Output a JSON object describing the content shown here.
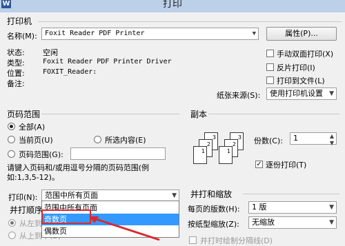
{
  "window": {
    "title": "打印",
    "app_icon": "W"
  },
  "printer": {
    "section": "打印机",
    "name_label": "名称(M):",
    "name_value": "Foxit Reader PDF Printer",
    "properties_btn": "属性(P)...",
    "status_label": "状态:",
    "status_value": "空闲",
    "type_label": "类型:",
    "type_value": "Foxit Reader PDF Printer Driver",
    "where_label": "位置:",
    "where_value": "FOXIT_Reader:",
    "comment_label": "备注:",
    "manual_duplex": "手动双面打印(X)",
    "reverse_print": "反片打印(I)",
    "print_to_file": "打印到文件(L)",
    "paper_source_label": "纸张来源(S):",
    "paper_source_value": "使用打印机设置"
  },
  "page_range": {
    "section": "页码范围",
    "all": "全部(A)",
    "current": "当前页(U)",
    "selection": "所选内容(E)",
    "pages": "页码范围(G):",
    "hint": "请键入页码和/或用逗号分隔的页码范围(例如:1,3,5-12)。"
  },
  "copies": {
    "section": "副本",
    "count_label": "份数(C):",
    "count_value": "1",
    "collate": "逐份打印(T)",
    "page_labels": [
      "3",
      "2",
      "1"
    ]
  },
  "print": {
    "label": "打印(N):",
    "value": "范围中所有页面",
    "options": [
      "范围中所有页面",
      "奇数页",
      "偶数页"
    ],
    "order_section": "并打顺序",
    "order_left_right": "从左到右(F)",
    "order_top_bottom": "从上到下(B)"
  },
  "zoom": {
    "section": "并打和缩放",
    "pages_per_sheet_label": "每页的版数(H):",
    "pages_per_sheet_value": "1 版",
    "scale_label": "按纸型缩放(Z):",
    "scale_value": "无缩放",
    "partial_text": "并打时绘制分隔线(D)"
  },
  "colors": {
    "accent": "#3399ff",
    "highlight_box": "#d9282f"
  }
}
